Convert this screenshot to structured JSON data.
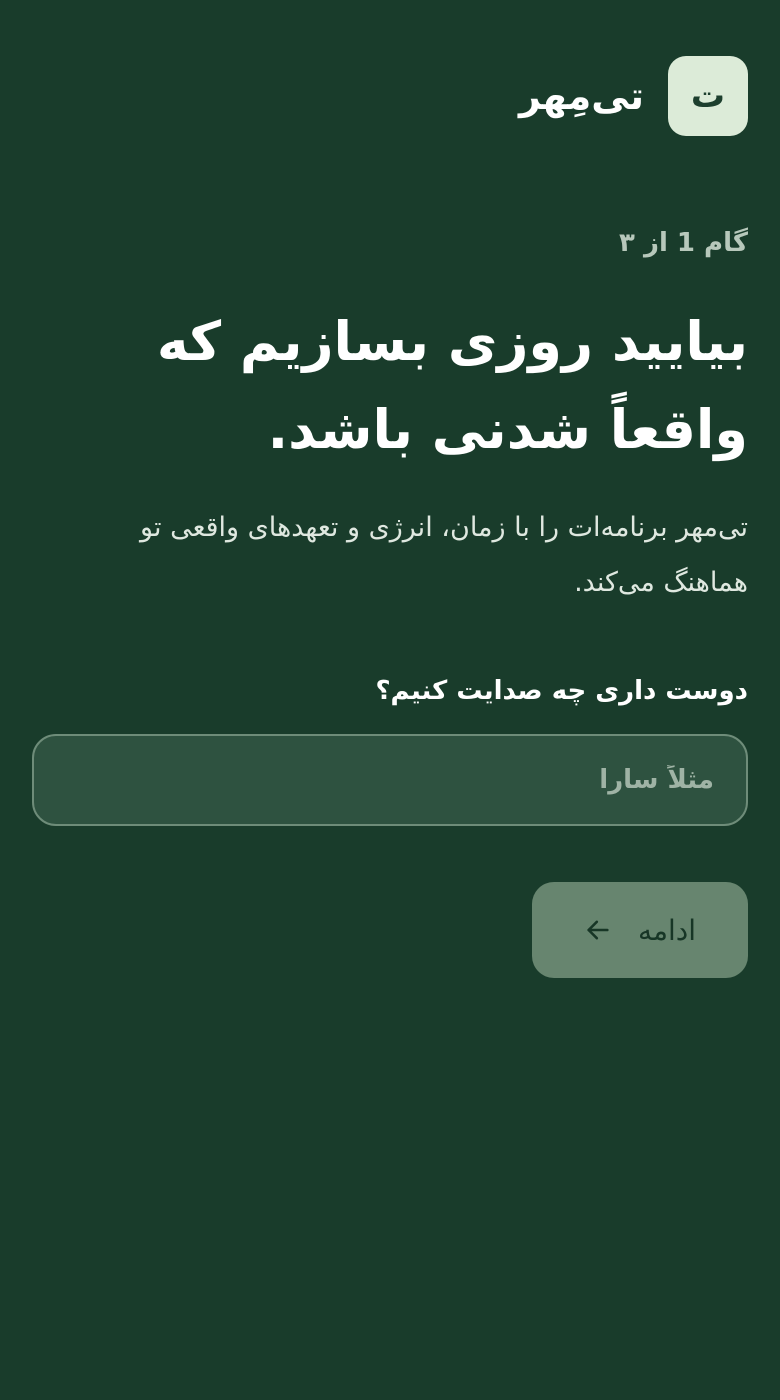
{
  "header": {
    "logo_letter": "ت",
    "app_name": "تی‌مِهر"
  },
  "step": {
    "label": "گام 1 از ۳"
  },
  "headline": "بیایید روزی بسازیم که واقعاً شدنی باشد.",
  "description": "تی‌مهر برنامه‌ات را با زمان، انرژی و تعهدهای واقعی تو هماهنگ می‌کند.",
  "form": {
    "name_label": "دوست داری چه صدایت کنیم؟",
    "name_value": "",
    "name_placeholder": "مثلاً سارا"
  },
  "continue_button": {
    "label": "ادامه",
    "icon": "arrow-left-icon"
  },
  "colors": {
    "background": "#193c2b",
    "logo_tile": "#dcebd8",
    "input_background": "#2e5240",
    "input_border": "#6e8c79",
    "button_background": "#67856f"
  }
}
